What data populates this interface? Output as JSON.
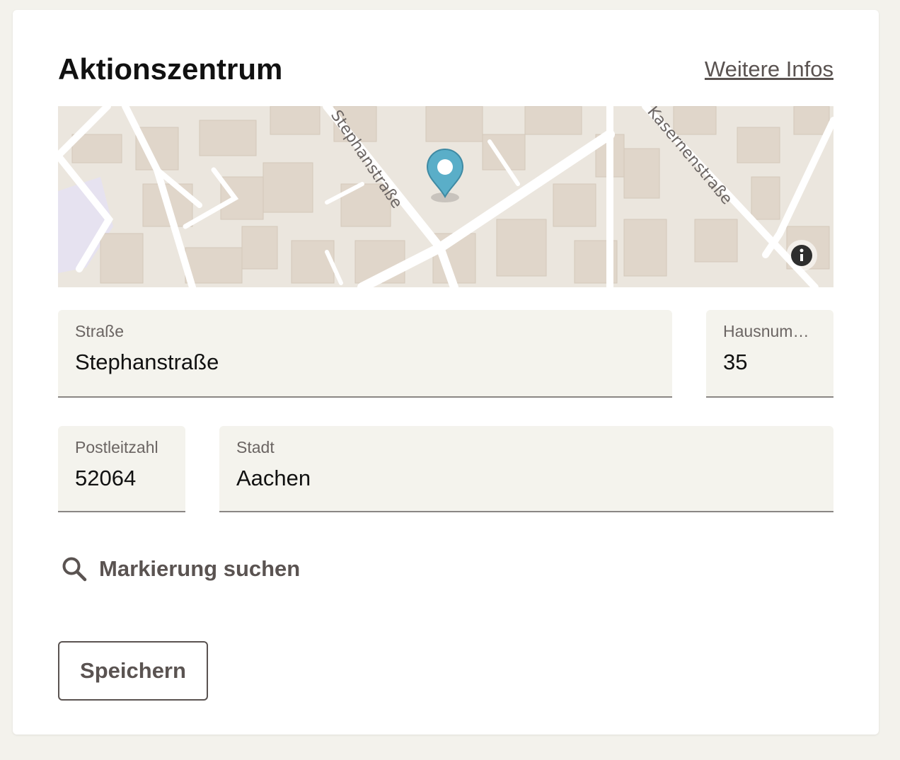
{
  "card": {
    "title": "Aktionszentrum",
    "more_link": "Weitere Infos"
  },
  "map": {
    "street_labels": [
      "Stephanstraße",
      "Kasernenstraße"
    ],
    "marker_icon": "map-pin-icon",
    "info_icon": "info-icon",
    "marker_color": "#5aaec8"
  },
  "form": {
    "street": {
      "label": "Straße",
      "value": "Stephanstraße"
    },
    "house_number": {
      "label": "Hausnummer",
      "value": "35"
    },
    "postal_code": {
      "label": "Postleitzahl",
      "value": "52064"
    },
    "city": {
      "label": "Stadt",
      "value": "Aachen"
    }
  },
  "search_action": {
    "label": "Markierung suchen",
    "icon": "search-icon"
  },
  "save_button": {
    "label": "Speichern"
  }
}
